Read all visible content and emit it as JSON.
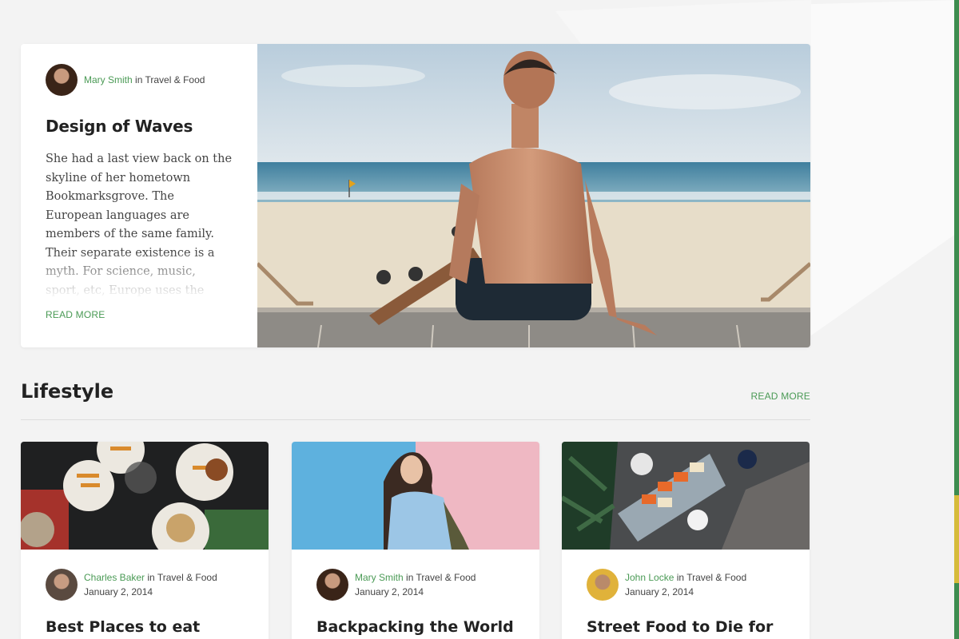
{
  "featured": {
    "author": "Mary Smith",
    "in_text": "in",
    "category": "Travel & Food",
    "title": "Design of Waves",
    "body": "She had a last view back on the skyline of her hometown Bookmarksgrove. The European languages are members of the same family. Their separate existence is a myth. For science, music, sport, etc, Europe uses the same vocabulary. The languages",
    "read_more": "READ MORE"
  },
  "section": {
    "title": "Lifestyle",
    "read_more": "READ MORE"
  },
  "cards": [
    {
      "author": "Charles Baker",
      "in_text": "in",
      "category": "Travel & Food",
      "date": "January 2, 2014",
      "title": "Best Places to eat when"
    },
    {
      "author": "Mary Smith",
      "in_text": "in",
      "category": "Travel & Food",
      "date": "January 2, 2014",
      "title": "Backpacking the World"
    },
    {
      "author": "John Locke",
      "in_text": "in",
      "category": "Travel & Food",
      "date": "January 2, 2014",
      "title": "Street Food to Die for in"
    }
  ],
  "colors": {
    "accent": "#4a9a55",
    "background": "#f3f3f3",
    "edge_green": "#3d8c4f",
    "edge_yellow": "#d6bb3a"
  }
}
